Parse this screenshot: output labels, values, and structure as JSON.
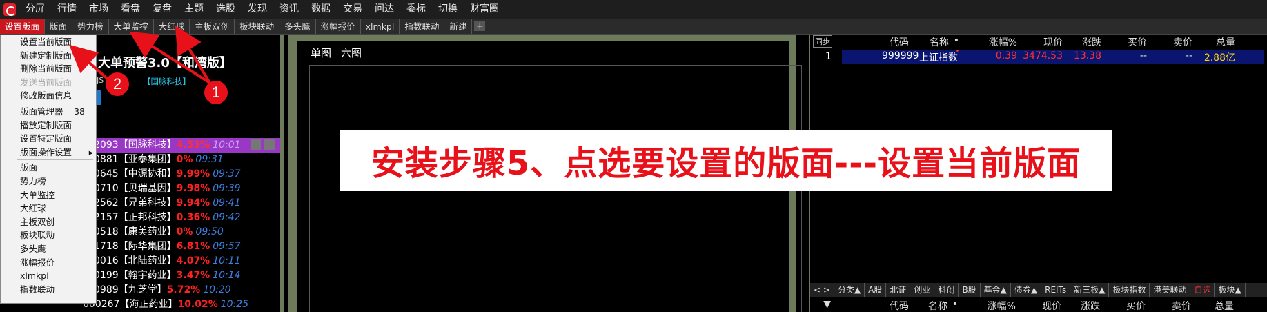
{
  "menubar": {
    "items": [
      "分屏",
      "行情",
      "市场",
      "看盘",
      "复盘",
      "主题",
      "选股",
      "发现",
      "资讯",
      "数据",
      "交易",
      "问达",
      "委标",
      "切换",
      "财富圈"
    ]
  },
  "tabbar": {
    "tabs": [
      "设置版面",
      "版面",
      "势力榜",
      "大单监控",
      "大红球",
      "主板双创",
      "板块联动",
      "多头鹰",
      "涨幅报价",
      "xlmkpl",
      "指数联动",
      "新建"
    ],
    "plus": "+"
  },
  "dropdown": {
    "items": [
      {
        "label": "设置当前版面"
      },
      {
        "label": "新建定制版面"
      },
      {
        "label": "删除当前版面"
      },
      {
        "label": "发送当前版面",
        "disabled": true
      },
      {
        "label": "修改版面信息"
      },
      {
        "sep": true
      },
      {
        "label": "版面管理器",
        "count": "38"
      },
      {
        "label": "播放定制版面"
      },
      {
        "label": "设置特定版面"
      },
      {
        "label": "版面操作设置",
        "arrow": "▸"
      },
      {
        "sep": true
      },
      {
        "label": "版面"
      },
      {
        "label": "势力榜"
      },
      {
        "label": "大单监控"
      },
      {
        "label": "大红球"
      },
      {
        "label": "主板双创"
      },
      {
        "label": "板块联动"
      },
      {
        "label": "多头鹰"
      },
      {
        "label": "涨幅报价"
      },
      {
        "label": "xlmkpl"
      },
      {
        "label": "指数联动"
      }
    ]
  },
  "left_panel": {
    "title": "大单预警3.0【和湾版】",
    "tag1": "JS",
    "tag2": "【国脉科技】",
    "rows": [
      {
        "code": "2093",
        "name": "【国脉科技】",
        "pct": "4.53%",
        "time": "10:01",
        "highlight": true
      },
      {
        "code": "0881",
        "name": "【亚泰集团】",
        "pct": "0%",
        "time": "09:31"
      },
      {
        "code": "0645",
        "name": "【中源协和】",
        "pct": "9.99%",
        "time": "09:37"
      },
      {
        "code": "0710",
        "name": "【贝瑞基因】",
        "pct": "9.98%",
        "time": "09:39"
      },
      {
        "code": "2562",
        "name": "【兄弟科技】",
        "pct": "9.94%",
        "time": "09:41"
      },
      {
        "code": "2157",
        "name": "【正邦科技】",
        "pct": "0.36%",
        "time": "09:42"
      },
      {
        "code": "0518",
        "name": "【康美药业】",
        "pct": "0%",
        "time": "09:50"
      },
      {
        "code": "1718",
        "name": "【际华集团】",
        "pct": "6.81%",
        "time": "09:57"
      },
      {
        "code": "0016",
        "name": "【北陆药业】",
        "pct": "4.07%",
        "time": "10:11"
      },
      {
        "code": "0199",
        "name": "【翰宇药业】",
        "pct": "3.47%",
        "time": "10:14"
      },
      {
        "code": "0989",
        "name": "【九芝堂】",
        "pct": "5.72%",
        "time": "10:20"
      },
      {
        "code": "600267",
        "name": "【海正药业】",
        "pct": "10.02%",
        "time": "10:25"
      }
    ]
  },
  "mid_panel": {
    "tabs": [
      "单图",
      "六图"
    ]
  },
  "right_panel": {
    "sync": "同步",
    "headers": [
      "代码",
      "名称",
      "•",
      "涨幅%",
      "现价",
      "涨跌",
      "买价",
      "卖价",
      "总量"
    ],
    "row": {
      "idx": "1",
      "code": "999999",
      "name": "上证指数",
      "dot": "•",
      "pct": "0.39",
      "price": "3474.53",
      "change": "13.38",
      "bid": "--",
      "ask": "--",
      "volume": "2.88亿"
    },
    "bottom_tabs": [
      "< >",
      "分类▲",
      "A股",
      "北证",
      "创业",
      "科创",
      "B股",
      "基金▲",
      "债券▲",
      "REITs",
      "新三板▲",
      "板块指数",
      "港美联动",
      "自选",
      "板块▲"
    ],
    "headers2": [
      "▼",
      "代码",
      "名称",
      "•",
      "涨幅%",
      "现价",
      "涨跌",
      "买价",
      "卖价",
      "总量"
    ]
  },
  "overlay": {
    "banner": "安装步骤5、点选要设置的版面---设置当前版面",
    "marker1": "1",
    "marker2": "2"
  },
  "colors": {
    "accent": "#c8161e",
    "overlay_red": "#e8111a",
    "up": "#ff2020",
    "time_blue": "#3f7fe0",
    "highlight": "#9a38c6"
  }
}
